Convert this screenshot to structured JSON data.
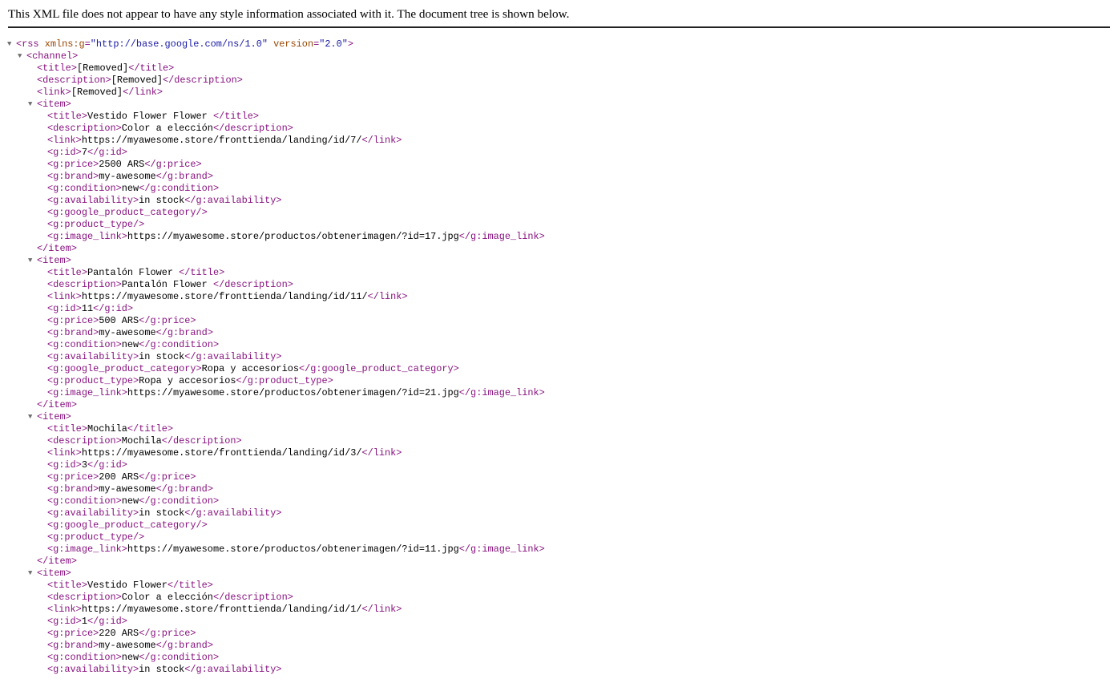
{
  "header": {
    "message": "This XML file does not appear to have any style information associated with it. The document tree is shown below."
  },
  "rss": {
    "open_tag": "<rss",
    "attr1_name": "xmlns:g",
    "attr1_value": "\"http://base.google.com/ns/1.0\"",
    "attr2_name": "version",
    "attr2_value": "\"2.0\"",
    "close_bracket": ">"
  },
  "channel": {
    "open": "<channel>",
    "title": "[Removed]",
    "description": "[Removed]",
    "link": "[Removed]"
  },
  "items": [
    {
      "title": "Vestido Flower Flower ",
      "description": "Color a elección",
      "link": "https://myawesome.store/fronttienda/landing/id/7/",
      "id": "7",
      "price": "2500 ARS",
      "brand": "my-awesome",
      "condition": "new",
      "availability": "in stock",
      "google_product_category": "",
      "product_type": "",
      "image_link": "https://myawesome.store/productos/obtenerimagen/?id=17.jpg"
    },
    {
      "title": "Pantalón Flower ",
      "description": "Pantalón Flower ",
      "link": "https://myawesome.store/fronttienda/landing/id/11/",
      "id": "11",
      "price": "500 ARS",
      "brand": "my-awesome",
      "condition": "new",
      "availability": "in stock",
      "google_product_category": "Ropa y accesorios",
      "product_type": "Ropa y accesorios",
      "image_link": "https://myawesome.store/productos/obtenerimagen/?id=21.jpg"
    },
    {
      "title": "Mochila",
      "description": "Mochila",
      "link": "https://myawesome.store/fronttienda/landing/id/3/",
      "id": "3",
      "price": "200 ARS",
      "brand": "my-awesome",
      "condition": "new",
      "availability": "in stock",
      "google_product_category": "",
      "product_type": "",
      "image_link": "https://myawesome.store/productos/obtenerimagen/?id=11.jpg"
    },
    {
      "title": "Vestido Flower",
      "description": "Color a elección",
      "link": "https://myawesome.store/fronttienda/landing/id/1/",
      "id": "1",
      "price": "220 ARS",
      "brand": "my-awesome",
      "condition": "new",
      "availability": "in stock"
    }
  ],
  "colors": {
    "tag": "#881280",
    "attr_name": "#994500",
    "attr_value": "#1a1aa6",
    "text": "#000000",
    "toggle": "#6e6e6e"
  },
  "icons": {
    "expand_toggle": "triangle-down-icon"
  }
}
